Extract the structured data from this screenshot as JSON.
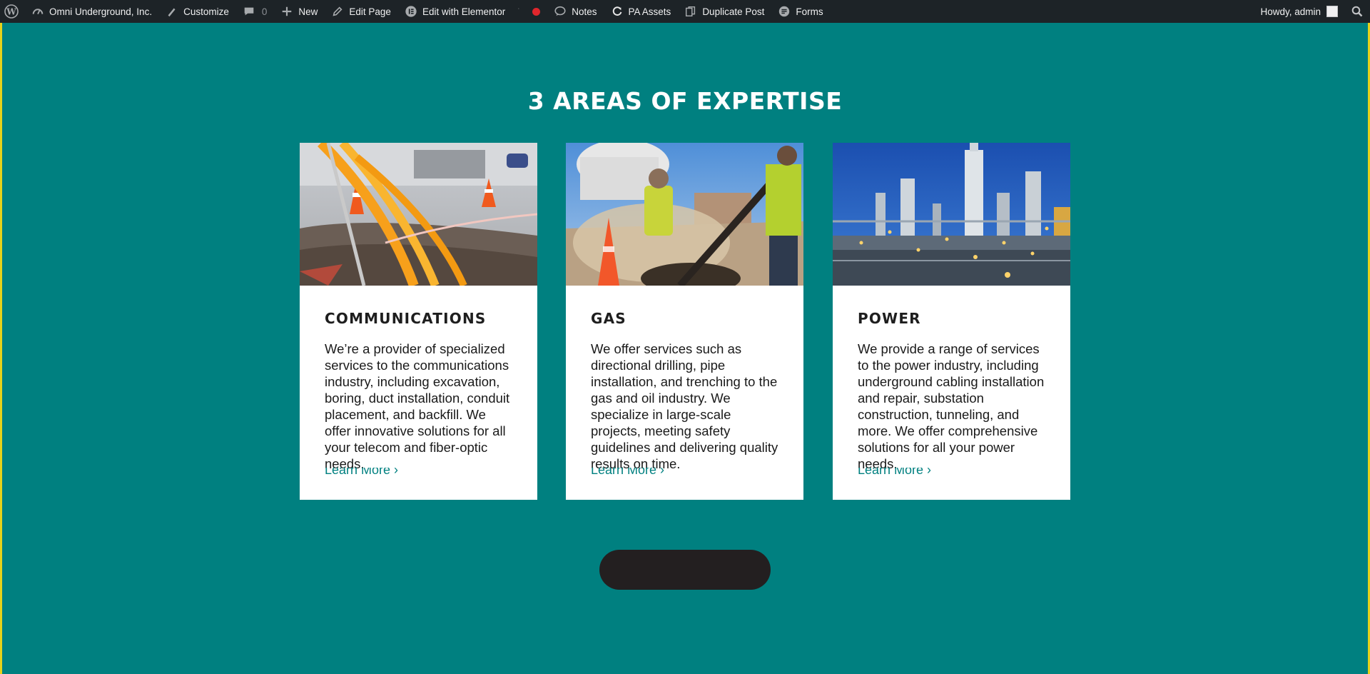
{
  "admin_bar": {
    "site_name": "Omni Underground, Inc.",
    "customize": "Customize",
    "comments_count": "0",
    "new": "New",
    "edit_page": "Edit Page",
    "edit_elementor": "Edit with Elementor",
    "notes": "Notes",
    "pa_assets": "PA Assets",
    "duplicate_post": "Duplicate Post",
    "forms": "Forms",
    "howdy": "Howdy, admin"
  },
  "section": {
    "title": "3 AREAS OF EXPERTISE"
  },
  "cards": [
    {
      "title": "COMMUNICATIONS",
      "text": "We’re a provider of specialized services to the communications industry, including excavation, boring, duct installation, conduit placement, and backfill. We offer innovative solutions for all your telecom and fiber-optic needs.",
      "link": "Learn More ›"
    },
    {
      "title": "GAS",
      "text": "We offer services such as directional drilling, pipe installation, and trenching to the gas and oil industry. We specialize in large-scale projects, meeting safety guidelines and delivering quality results on time.",
      "link": "Learn More ›"
    },
    {
      "title": "POWER",
      "text": "We provide a range of services to the power industry, including underground cabling installation and repair, substation construction, tunneling, and more. We offer comprehensive solutions for all your power needs.",
      "link": "Learn More ›"
    }
  ],
  "colors": {
    "background": "#008080",
    "admin_bar": "#1d2327",
    "button": "#231f20",
    "link": "#008080"
  }
}
